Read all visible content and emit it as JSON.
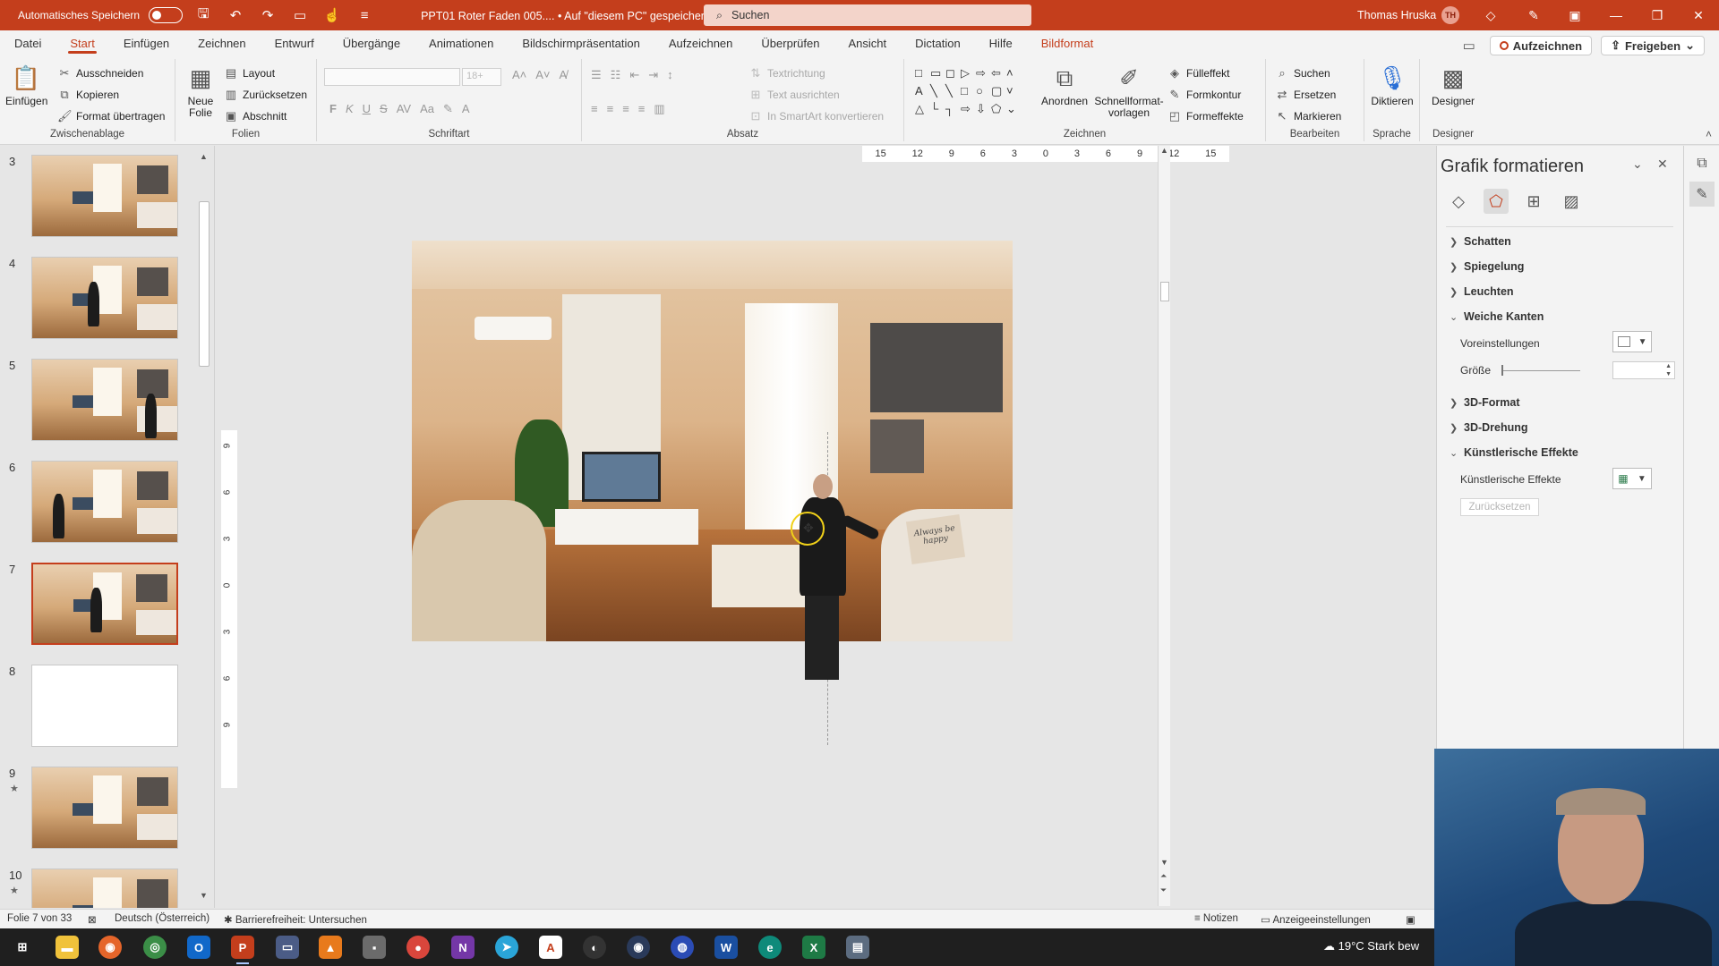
{
  "titlebar": {
    "autosave_label": "Automatisches Speichern",
    "doc_title": "PPT01 Roter Faden 005....  •  Auf \"diesem PC\" gespeichert  ⌄",
    "search_placeholder": "Suchen",
    "user_name": "Thomas Hruska",
    "user_initials": "TH"
  },
  "menu": {
    "tabs": [
      "Datei",
      "Start",
      "Einfügen",
      "Zeichnen",
      "Entwurf",
      "Übergänge",
      "Animationen",
      "Bildschirmpräsentation",
      "Aufzeichnen",
      "Überprüfen",
      "Ansicht",
      "Dictation",
      "Hilfe",
      "Bildformat"
    ],
    "record_button": "Aufzeichnen",
    "share_button": "Freigeben"
  },
  "ribbon": {
    "clipboard": {
      "paste": "Einfügen",
      "cut": "Ausschneiden",
      "copy": "Kopieren",
      "format_painter": "Format übertragen",
      "label": "Zwischenablage"
    },
    "slides": {
      "new_slide": "Neue Folie",
      "layout": "Layout",
      "reset": "Zurücksetzen",
      "section": "Abschnitt",
      "label": "Folien"
    },
    "font": {
      "size": "18+",
      "bold": "F",
      "italic": "K",
      "underline": "U",
      "strike": "S",
      "label": "Schriftart"
    },
    "paragraph": {
      "text_direction": "Textrichtung",
      "align_text": "Text ausrichten",
      "smartart": "In SmartArt konvertieren",
      "label": "Absatz"
    },
    "drawing": {
      "arrange": "Anordnen",
      "quick_styles": "Schnellformat-vorlagen",
      "fill": "Fülleffekt",
      "outline": "Formkontur",
      "effects": "Formeffekte",
      "label": "Zeichnen"
    },
    "editing": {
      "find": "Suchen",
      "replace": "Ersetzen",
      "select": "Markieren",
      "label": "Bearbeiten"
    },
    "voice": {
      "dictate": "Diktieren",
      "label": "Sprache"
    },
    "designer": {
      "designer": "Designer",
      "label": "Designer"
    }
  },
  "thumbnails": [
    {
      "num": "3",
      "star": "",
      "kind": "room"
    },
    {
      "num": "4",
      "star": "",
      "kind": "room-person"
    },
    {
      "num": "5",
      "star": "",
      "kind": "room-person"
    },
    {
      "num": "6",
      "star": "",
      "kind": "room-person"
    },
    {
      "num": "7",
      "star": "",
      "kind": "room-person",
      "selected": true
    },
    {
      "num": "8",
      "star": "",
      "kind": "blank"
    },
    {
      "num": "9",
      "star": "★",
      "kind": "room"
    },
    {
      "num": "10",
      "star": "★",
      "kind": "room"
    }
  ],
  "ruler": {
    "horizontal": [
      "15",
      "12",
      "9",
      "6",
      "3",
      "0",
      "3",
      "6",
      "9",
      "12",
      "15"
    ],
    "vertical": [
      "9",
      "6",
      "3",
      "0",
      "3",
      "6",
      "9"
    ]
  },
  "slide_image": {
    "pillow_text": "Always be happy"
  },
  "format_pane": {
    "title": "Grafik formatieren",
    "sections": {
      "shadow": "Schatten",
      "reflection": "Spiegelung",
      "glow": "Leuchten",
      "soft_edges": "Weiche Kanten",
      "presets": "Voreinstellungen",
      "size": "Größe",
      "format_3d": "3D-Format",
      "rotation_3d": "3D-Drehung",
      "artistic": "Künstlerische Effekte",
      "artistic_sub": "Künstlerische Effekte",
      "reset": "Zurücksetzen"
    }
  },
  "statusbar": {
    "slide_info": "Folie 7 von 33",
    "language": "Deutsch (Österreich)",
    "accessibility": "Barrierefreiheit: Untersuchen",
    "notes": "Notizen",
    "display_settings": "Anzeigeeinstellungen"
  },
  "taskbar": {
    "weather": "19°C  Stark bew"
  },
  "colors": {
    "accent": "#c43e1c",
    "cursor_ring": "#f0d019"
  }
}
